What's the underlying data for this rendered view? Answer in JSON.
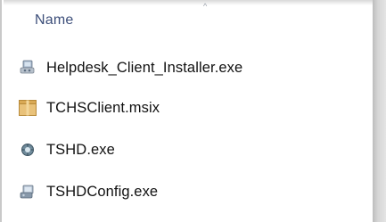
{
  "column": {
    "header": "Name",
    "sort_glyph": "^"
  },
  "files": [
    {
      "name": "Helpdesk_Client_Installer.exe",
      "icon": "exe-installer-icon"
    },
    {
      "name": "TCHSClient.msix",
      "icon": "msix-package-icon"
    },
    {
      "name": "TSHD.exe",
      "icon": "exe-app-icon"
    },
    {
      "name": "TSHDConfig.exe",
      "icon": "exe-config-icon"
    }
  ]
}
